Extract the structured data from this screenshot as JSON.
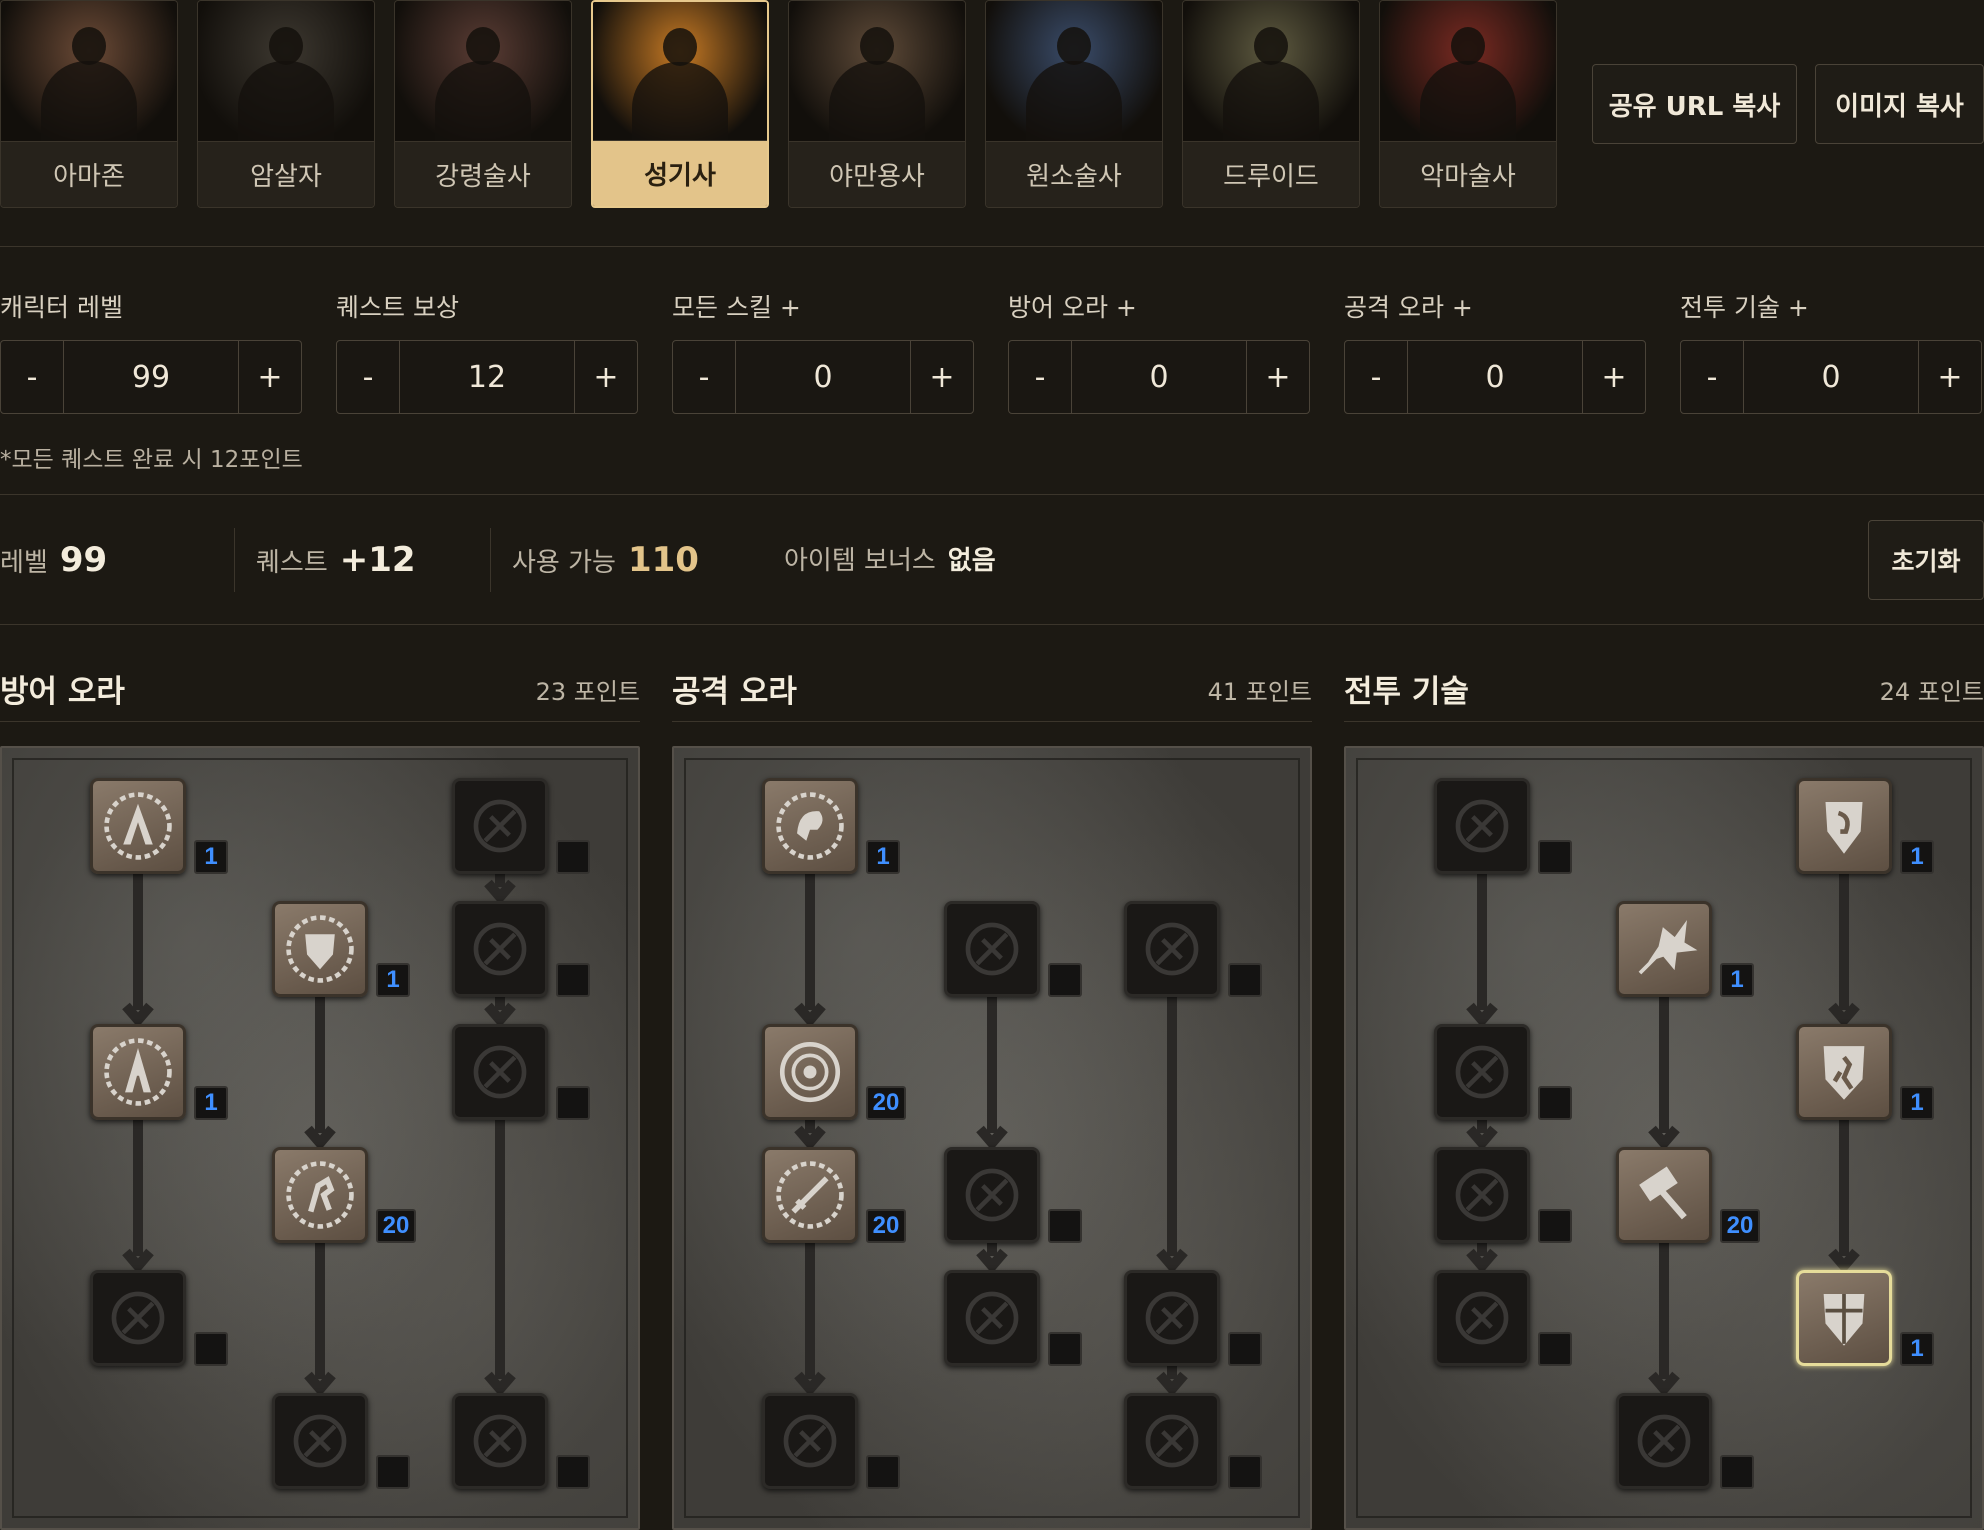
{
  "classes": [
    {
      "label": "아마존",
      "active": false,
      "tint": "#6b4a36"
    },
    {
      "label": "암살자",
      "active": false,
      "tint": "#3d3830"
    },
    {
      "label": "강령술사",
      "active": false,
      "tint": "#5a3c34"
    },
    {
      "label": "성기사",
      "active": true,
      "tint": "#c77a24"
    },
    {
      "label": "야만용사",
      "active": false,
      "tint": "#5e4a38"
    },
    {
      "label": "원소술사",
      "active": false,
      "tint": "#3a4c6a"
    },
    {
      "label": "드루이드",
      "active": false,
      "tint": "#5e5a40"
    },
    {
      "label": "악마술사",
      "active": false,
      "tint": "#7a2a22"
    }
  ],
  "actions": {
    "share_url": "공유 URL 복사",
    "copy_image": "이미지 복사",
    "reset": "초기화"
  },
  "steppers": [
    {
      "label": "캐릭터 레벨",
      "value": "99"
    },
    {
      "label": "퀘스트 보상",
      "value": "12"
    },
    {
      "label": "모든 스킬 +",
      "value": "0"
    },
    {
      "label": "방어 오라 +",
      "value": "0"
    },
    {
      "label": "공격 오라 +",
      "value": "0"
    },
    {
      "label": "전투 기술 +",
      "value": "0"
    }
  ],
  "stepper_minus": "-",
  "stepper_plus": "+",
  "note": "*모든 퀘스트 완료 시 12포인트",
  "summary": {
    "level_label": "레벨",
    "level_value": "99",
    "quest_label": "퀘스트",
    "quest_value": "+12",
    "available_label": "사용 가능",
    "available_value": "110",
    "item_label": "아이템 보너스",
    "item_value": "없음"
  },
  "trees": [
    {
      "name": "방어 오라",
      "points": "23 포인트",
      "skills": [
        {
          "icon": "prayer",
          "col": 0,
          "row": 0,
          "on": true,
          "level": "1"
        },
        {
          "icon": "resist-fire",
          "col": 2,
          "row": 0,
          "on": false,
          "level": ""
        },
        {
          "icon": "defiance",
          "col": 1,
          "row": 1,
          "on": true,
          "level": "1"
        },
        {
          "icon": "resist-cold",
          "col": 2,
          "row": 1,
          "on": false,
          "level": ""
        },
        {
          "icon": "cleansing",
          "col": 0,
          "row": 2,
          "on": true,
          "level": "1"
        },
        {
          "icon": "resist-lightning",
          "col": 2,
          "row": 2,
          "on": false,
          "level": ""
        },
        {
          "icon": "vigor",
          "col": 1,
          "row": 3,
          "on": true,
          "level": "20"
        },
        {
          "icon": "meditation",
          "col": 0,
          "row": 4,
          "on": false,
          "level": ""
        },
        {
          "icon": "redemption",
          "col": 1,
          "row": 5,
          "on": false,
          "level": ""
        },
        {
          "icon": "salvation",
          "col": 2,
          "row": 5,
          "on": false,
          "level": ""
        }
      ]
    },
    {
      "name": "공격 오라",
      "points": "41 포인트",
      "skills": [
        {
          "icon": "might",
          "col": 0,
          "row": 0,
          "on": true,
          "level": "1"
        },
        {
          "icon": "holy-fire",
          "col": 1,
          "row": 1,
          "on": false,
          "level": ""
        },
        {
          "icon": "thorns",
          "col": 2,
          "row": 1,
          "on": false,
          "level": ""
        },
        {
          "icon": "blessed-aim",
          "col": 0,
          "row": 2,
          "on": true,
          "level": "20"
        },
        {
          "icon": "concentration",
          "col": 0,
          "row": 3,
          "on": true,
          "level": "20"
        },
        {
          "icon": "holy-freeze",
          "col": 1,
          "row": 3,
          "on": false,
          "level": ""
        },
        {
          "icon": "holy-shock",
          "col": 1,
          "row": 4,
          "on": false,
          "level": ""
        },
        {
          "icon": "sanctuary",
          "col": 2,
          "row": 4,
          "on": false,
          "level": ""
        },
        {
          "icon": "fanaticism",
          "col": 0,
          "row": 5,
          "on": false,
          "level": ""
        },
        {
          "icon": "conviction",
          "col": 2,
          "row": 5,
          "on": false,
          "level": ""
        }
      ]
    },
    {
      "name": "전투 기술",
      "points": "24 포인트",
      "skills": [
        {
          "icon": "sacrifice",
          "col": 0,
          "row": 0,
          "on": false,
          "level": ""
        },
        {
          "icon": "smite",
          "col": 2,
          "row": 0,
          "on": true,
          "level": "1"
        },
        {
          "icon": "holy-bolt",
          "col": 1,
          "row": 1,
          "on": true,
          "level": "1"
        },
        {
          "icon": "zeal",
          "col": 0,
          "row": 2,
          "on": false,
          "level": ""
        },
        {
          "icon": "charge",
          "col": 2,
          "row": 2,
          "on": true,
          "level": "1"
        },
        {
          "icon": "vengeance",
          "col": 0,
          "row": 3,
          "on": false,
          "level": ""
        },
        {
          "icon": "blessed-hammer",
          "col": 1,
          "row": 3,
          "on": true,
          "level": "20"
        },
        {
          "icon": "conversion",
          "col": 0,
          "row": 4,
          "on": false,
          "level": ""
        },
        {
          "icon": "holy-shield",
          "col": 2,
          "row": 4,
          "on": true,
          "level": "1",
          "selected": true
        },
        {
          "icon": "fist-of-heavens",
          "col": 1,
          "row": 5,
          "on": false,
          "level": ""
        }
      ]
    }
  ]
}
